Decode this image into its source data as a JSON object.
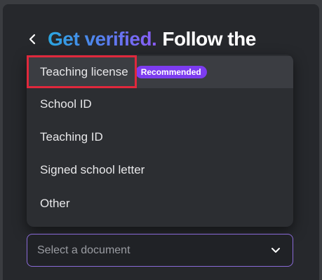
{
  "header": {
    "accent": "Get verified.",
    "rest": "Follow the"
  },
  "dropdown": {
    "options": [
      {
        "label": "Teaching license",
        "badge": "Recommended"
      },
      {
        "label": "School ID"
      },
      {
        "label": "Teaching ID"
      },
      {
        "label": "Signed school letter"
      },
      {
        "label": "Other"
      }
    ]
  },
  "select": {
    "placeholder": "Select a document"
  },
  "colors": {
    "panel": "#26282c",
    "dropdown": "#2c2e32",
    "badge": "#7d3cf0",
    "highlight_box": "#e0283c",
    "select_border": "#8a6ad8"
  },
  "icons": {
    "back": "chevron-left-icon",
    "select": "chevron-down-icon"
  }
}
